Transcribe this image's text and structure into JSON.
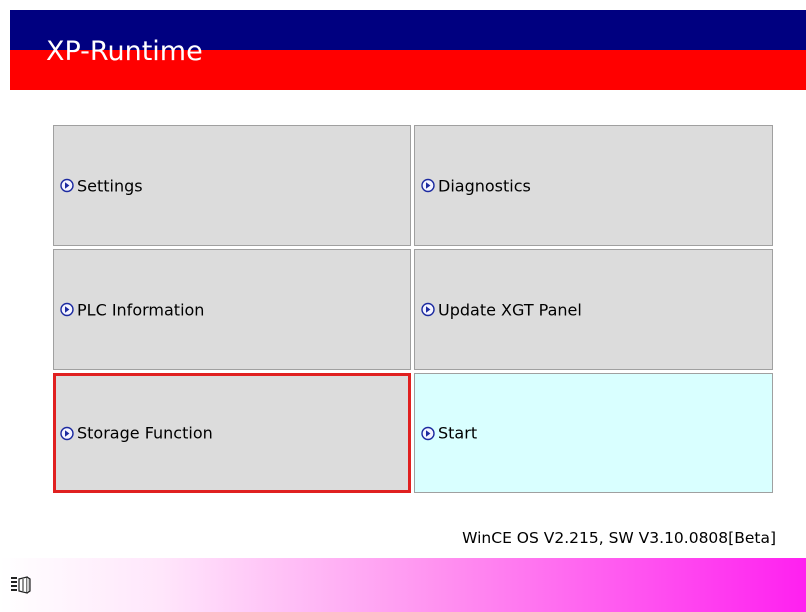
{
  "app": {
    "title": "XP-Runtime"
  },
  "menu": {
    "settings": "Settings",
    "diagnostics": "Diagnostics",
    "plc_information": "PLC Information",
    "update_panel": "Update XGT Panel",
    "storage_function": "Storage Function",
    "start": "Start"
  },
  "version_text": "WinCE OS V2.215, SW V3.10.0808[Beta]",
  "colors": {
    "header_top": "#000080",
    "header_bottom": "#ff0000",
    "button_bg": "#dcdcdc",
    "start_bg": "#d9ffff",
    "selection": "#e02020",
    "footer_gradient_end": "#ff20f0"
  },
  "icons": {
    "menu_arrow": "circle-arrow-right-icon",
    "tray": "wince-taskbar-icon"
  }
}
